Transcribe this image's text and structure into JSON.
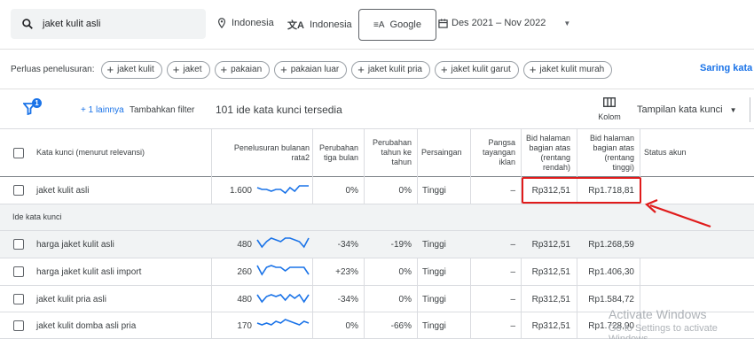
{
  "search": {
    "query": "jaket kulit asli"
  },
  "targeting": {
    "location": "Indonesia",
    "language": "Indonesia",
    "network": "Google",
    "date_range": "Des 2021 – Nov 2022"
  },
  "refine": {
    "label": "Perluas penelusuran:",
    "chips": [
      "jaket kulit",
      "jaket",
      "pakaian",
      "pakaian luar",
      "jaket kulit pria",
      "jaket kulit garut",
      "jaket kulit murah"
    ],
    "link": "Saring kata k"
  },
  "filter": {
    "badge": "1",
    "more_link": "+ 1 lainnya",
    "add_filter": "Tambahkan filter",
    "count_text": "101 ide kata kunci tersedia",
    "columns_label": "Kolom",
    "view_label": "Tampilan kata kunci"
  },
  "headers": {
    "keyword": "Kata kunci (menurut relevansi)",
    "avg_searches": [
      "Penelusuran bulanan",
      "rata2"
    ],
    "change_3m": [
      "Perubahan",
      "tiga bulan"
    ],
    "change_yoy": [
      "Perubahan",
      "tahun ke",
      "tahun"
    ],
    "competition": "Persaingan",
    "impression_share": [
      "Pangsa",
      "tayangan",
      "iklan"
    ],
    "bid_low": [
      "Bid halaman",
      "bagian atas",
      "(rentang",
      "rendah)"
    ],
    "bid_high": [
      "Bid halaman",
      "bagian atas",
      "(rentang",
      "tinggi)"
    ],
    "account_status": "Status akun"
  },
  "main_row": {
    "keyword": "jaket kulit asli",
    "avg": "1.600",
    "change_3m": "0%",
    "change_yoy": "0%",
    "competition": "Tinggi",
    "share": "–",
    "bid_low": "Rp312,51",
    "bid_high": "Rp1.718,81",
    "trend": [
      6,
      5,
      5,
      4,
      5,
      5,
      3,
      6,
      4,
      7,
      7,
      7
    ]
  },
  "section_label": "Ide kata kunci",
  "rows": [
    {
      "keyword": "harga jaket kulit asli",
      "avg": "480",
      "change_3m": "-34%",
      "change_yoy": "-19%",
      "competition": "Tinggi",
      "share": "–",
      "bid_low": "Rp312,51",
      "bid_high": "Rp1.268,59",
      "trend": [
        7,
        3,
        6,
        8,
        7,
        6,
        8,
        8,
        7,
        6,
        3,
        8
      ]
    },
    {
      "keyword": "harga jaket kulit asli import",
      "avg": "260",
      "change_3m": "+23%",
      "change_yoy": "0%",
      "competition": "Tinggi",
      "share": "–",
      "bid_low": "Rp312,51",
      "bid_high": "Rp1.406,30",
      "trend": [
        8,
        3,
        7,
        8,
        7,
        7,
        5,
        7,
        7,
        7,
        7,
        3
      ]
    },
    {
      "keyword": "jaket kulit pria asli",
      "avg": "480",
      "change_3m": "-34%",
      "change_yoy": "0%",
      "competition": "Tinggi",
      "share": "–",
      "bid_low": "Rp312,51",
      "bid_high": "Rp1.584,72",
      "trend": [
        7,
        3,
        6,
        7,
        6,
        7,
        4,
        7,
        5,
        7,
        3,
        7
      ]
    },
    {
      "keyword": "jaket kulit domba asli pria",
      "avg": "170",
      "change_3m": "0%",
      "change_yoy": "-66%",
      "competition": "Tinggi",
      "share": "–",
      "bid_low": "Rp312,51",
      "bid_high": "Rp1.728,90",
      "trend": [
        6,
        5,
        6,
        5,
        7,
        6,
        8,
        7,
        6,
        5,
        7,
        6
      ]
    }
  ],
  "watermark": {
    "title": "Activate Windows",
    "subtitle": "Go to Settings to activate Windows."
  },
  "colors": {
    "accent": "#1a73e8",
    "highlight": "#e01b1b",
    "trendline": "#1a73e8"
  }
}
